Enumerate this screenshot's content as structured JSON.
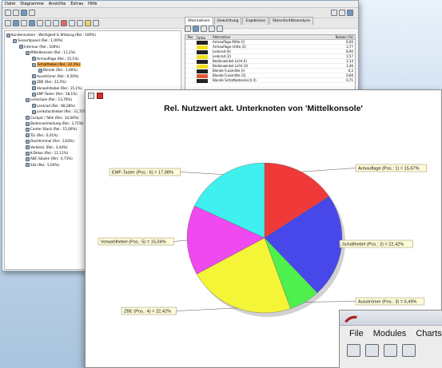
{
  "back_window": {
    "menu": [
      "Datei",
      "Diagramme",
      "Ansichte",
      "Extras",
      "Hilfe"
    ],
    "tabs": [
      "Alternativen",
      "Gewichtung",
      "Ergebnisse",
      "Stensitivitätsanalyse"
    ],
    "tree": [
      {
        "label": "Kundennutzen - Wertigkeit & Wirkung (Rel.: 100%)",
        "level": 0
      },
      {
        "label": "Gesamtpanel (Rel.: 1,00%)",
        "level": 1
      },
      {
        "label": "Interieur (Rel.: 100%)",
        "level": 2
      },
      {
        "label": "Mittelkonsole (Rel.: 11,2%)",
        "level": 3
      },
      {
        "label": "Armauflage (Rel.: 15,1%)",
        "level": 4
      },
      {
        "label": "Schalthebel (Rel.: 22,5%)",
        "level": 4,
        "selected": true
      },
      {
        "label": "Blende (Rel.: 1,00%)",
        "level": 5
      },
      {
        "label": "Ausströmer (Rel.: 6,50%)",
        "level": 4
      },
      {
        "label": "ZBE (Rel.: 22,5%)",
        "level": 4
      },
      {
        "label": "Vorwahlhebel (Rel.: 15,1%)",
        "level": 4
      },
      {
        "label": "EMF-Taster (Rel.: 18,1%)",
        "level": 4
      },
      {
        "label": "Lenksäule (Rel.: 13,76%)",
        "level": 3
      },
      {
        "label": "Lenkrad (Rel.: 68,28%)",
        "level": 4
      },
      {
        "label": "Lenkstockhebel (Rel.: 31,71%)",
        "level": 4
      },
      {
        "label": "Cockpit / Tafel (Rel.: 14,06%)",
        "level": 3
      },
      {
        "label": "Bodenverkleidung (Rel.: 3,71%)",
        "level": 3
      },
      {
        "label": "Center Stack (Rel.: 15,06%)",
        "level": 3
      },
      {
        "label": "Tür (Rel.: 6,01%)",
        "level": 3
      },
      {
        "label": "Dachhimmel (Rel.: 3,63%)",
        "level": 3
      },
      {
        "label": "Verkleid. (Rel.: 3,44%)",
        "level": 3
      },
      {
        "label": "K-Dekor (Rel.: 11,11%)",
        "level": 3
      },
      {
        "label": "ABC-Säulen (Rel.: 4,73%)",
        "level": 3
      },
      {
        "label": "Sitz (Rel.: 5,04%)",
        "level": 3
      }
    ],
    "grid_headers": [
      "Pos",
      "Farbe",
      "Alternative",
      "Nutzen [%]"
    ],
    "grid_rows": [
      {
        "pos": "",
        "color": "#222222",
        "name": "Armauflage Mitte (I)",
        "value": "6,00"
      },
      {
        "pos": "",
        "color": "#f0e020",
        "name": "Armauflage mitte (2)",
        "value": "3,77"
      },
      {
        "pos": "",
        "color": "#222222",
        "name": "Lenkrad (II)",
        "value": "8,90"
      },
      {
        "pos": "",
        "color": "#f0e020",
        "name": "Lenkrad (2)",
        "value": "1,57"
      },
      {
        "pos": "",
        "color": "#222222",
        "name": "Bedienwinkel Licht (I)",
        "value": "3,14"
      },
      {
        "pos": "",
        "color": "#f0e020",
        "name": "Bedienwinkel Licht (2)",
        "value": "1,46"
      },
      {
        "pos": "",
        "color": "#222222",
        "name": "Blende Fussmitte (I)",
        "value": "0,2"
      },
      {
        "pos": "",
        "color": "#e05a3a",
        "name": "Blende Fussmitte (2)",
        "value": "0,66"
      },
      {
        "pos": "",
        "color": "#222222",
        "name": "Blende Schaltbetesnisch (I)",
        "value": "0,71"
      }
    ]
  },
  "chart_window": {
    "chart_data": {
      "type": "pie",
      "title": "Rel. Nutzwert akt. Unterknoten von 'Mittelkonsole'",
      "slices": [
        {
          "label": "Armauflage (Pos.: 1) = 15,67%",
          "value": 15.67,
          "color": "#f03a3a"
        },
        {
          "label": "Schalthebel (Pos.: 2) = 22,42%",
          "value": 22.42,
          "color": "#4747ea"
        },
        {
          "label": "Ausströmer (Pos.: 3) = 6,49%",
          "value": 6.49,
          "color": "#4ef04e"
        },
        {
          "label": "ZBE (Pos.: 4) = 22,42%",
          "value": 22.42,
          "color": "#f5f538"
        },
        {
          "label": "Vorwahlhebel (Pos.: 5) = 15,04%",
          "value": 15.04,
          "color": "#ef49ef"
        },
        {
          "label": "EMF-Taster (Pos.: 6) = 17,98%",
          "value": 17.98,
          "color": "#3ff0ef"
        }
      ]
    }
  },
  "corner_window": {
    "menu": [
      "File",
      "Modules",
      "Charts"
    ]
  }
}
